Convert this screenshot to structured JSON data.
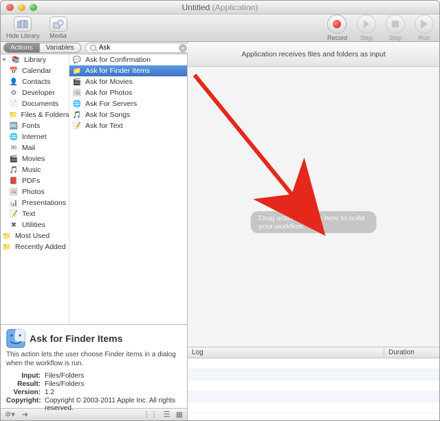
{
  "window": {
    "title_main": "Untitled",
    "title_suffix": "(Application)"
  },
  "toolbar": {
    "hide_library": "Hide Library",
    "media": "Media",
    "record": "Record",
    "step": "Step",
    "stop": "Stop",
    "run": "Run"
  },
  "tabs": {
    "actions": "Actions",
    "variables": "Variables"
  },
  "search": {
    "placeholder": "",
    "value": "Ask",
    "clear": "×"
  },
  "library": {
    "root": "Library",
    "items": [
      "Calendar",
      "Contacts",
      "Developer",
      "Documents",
      "Files & Folders",
      "Fonts",
      "Internet",
      "Mail",
      "Movies",
      "Music",
      "PDFs",
      "Photos",
      "Presentations",
      "Text",
      "Utilities"
    ],
    "smart": [
      "Most Used",
      "Recently Added"
    ]
  },
  "results": {
    "items": [
      {
        "label": "Ask for Confirmation",
        "icon": "dialog"
      },
      {
        "label": "Ask for Finder Items",
        "icon": "finder",
        "selected": true
      },
      {
        "label": "Ask for Movies",
        "icon": "movie"
      },
      {
        "label": "Ask for Photos",
        "icon": "photo"
      },
      {
        "label": "Ask For Servers",
        "icon": "globe"
      },
      {
        "label": "Ask for Songs",
        "icon": "music"
      },
      {
        "label": "Ask for Text",
        "icon": "text"
      }
    ]
  },
  "info": {
    "title": "Ask for Finder Items",
    "desc": "This action lets the user choose Finder items in a dialog when the workflow is run.",
    "input_k": "Input:",
    "input_v": "Files/Folders",
    "result_k": "Result:",
    "result_v": "Files/Folders",
    "version_k": "Version:",
    "version_v": "1.2",
    "copyright_k": "Copyright:",
    "copyright_v": "Copyright © 2003-2011 Apple Inc.  All rights reserved."
  },
  "workflow": {
    "receives": "Application receives files and folders as input",
    "drop_hint": "Drag actions or files here to build your workflow."
  },
  "log": {
    "col1": "Log",
    "col2": "Duration"
  },
  "status": {
    "gear": "✲",
    "arrow": "➔",
    "v1": "≡",
    "v2": "☰",
    "v3": "▦"
  }
}
